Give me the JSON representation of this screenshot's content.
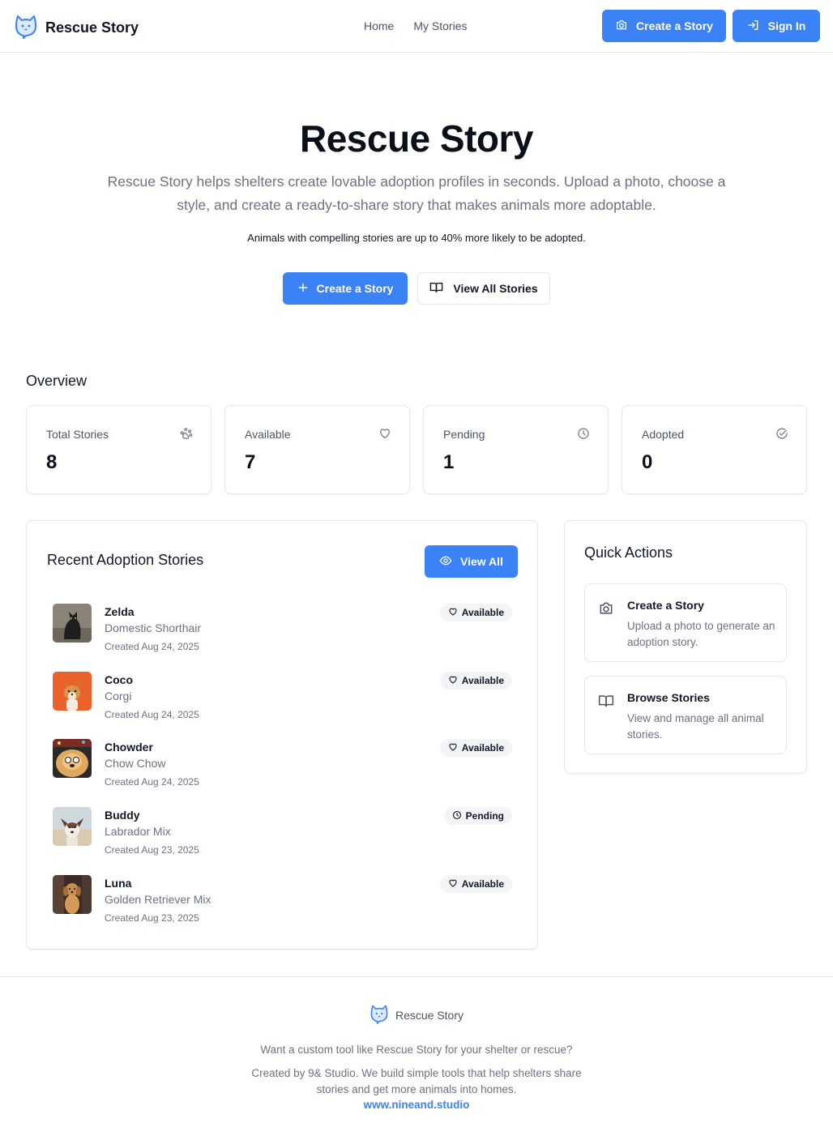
{
  "header": {
    "brand": "Rescue Story",
    "nav": [
      "Home",
      "My Stories"
    ],
    "create_label": "Create a Story",
    "signin_label": "Sign In"
  },
  "hero": {
    "title": "Rescue Story",
    "description": "Rescue Story helps shelters create lovable adoption profiles in seconds. Upload a photo, choose a style, and create a ready-to-share story that makes animals more adoptable.",
    "note": "Animals with compelling stories are up to 40% more likely to be adopted.",
    "create_label": "Create a Story",
    "view_label": "View All Stories"
  },
  "overview": {
    "title": "Overview",
    "stats": [
      {
        "label": "Total Stories",
        "value": "8",
        "icon": "paw-icon"
      },
      {
        "label": "Available",
        "value": "7",
        "icon": "heart-icon"
      },
      {
        "label": "Pending",
        "value": "1",
        "icon": "clock-icon"
      },
      {
        "label": "Adopted",
        "value": "0",
        "icon": "check-circle-icon"
      }
    ]
  },
  "recent": {
    "title": "Recent Adoption Stories",
    "view_all_label": "View All",
    "stories": [
      {
        "name": "Zelda",
        "breed": "Domestic Shorthair",
        "date": "Created Aug 24, 2025",
        "status": "Available",
        "status_icon": "heart-icon"
      },
      {
        "name": "Coco",
        "breed": "Corgi",
        "date": "Created Aug 24, 2025",
        "status": "Available",
        "status_icon": "heart-icon"
      },
      {
        "name": "Chowder",
        "breed": "Chow Chow",
        "date": "Created Aug 24, 2025",
        "status": "Available",
        "status_icon": "heart-icon"
      },
      {
        "name": "Buddy",
        "breed": "Labrador Mix",
        "date": "Created Aug 23, 2025",
        "status": "Pending",
        "status_icon": "clock-icon"
      },
      {
        "name": "Luna",
        "breed": "Golden Retriever Mix",
        "date": "Created Aug 23, 2025",
        "status": "Available",
        "status_icon": "heart-icon"
      }
    ]
  },
  "quick_actions": {
    "title": "Quick Actions",
    "items": [
      {
        "title": "Create a Story",
        "description": "Upload a photo to generate an adoption story.",
        "icon": "camera-icon"
      },
      {
        "title": "Browse Stories",
        "description": "View and manage all animal stories.",
        "icon": "book-icon"
      }
    ]
  },
  "footer": {
    "brand": "Rescue Story",
    "line1": "Want a custom tool like Rescue Story for your shelter or rescue?",
    "line2": "Created by 9& Studio. We build simple tools that help shelters share stories and get more animals into homes.",
    "link": "www.nineand.studio"
  },
  "colors": {
    "accent": "#3b82f6",
    "text": "#111827",
    "muted": "#6b7280",
    "border": "#e5e7eb"
  }
}
